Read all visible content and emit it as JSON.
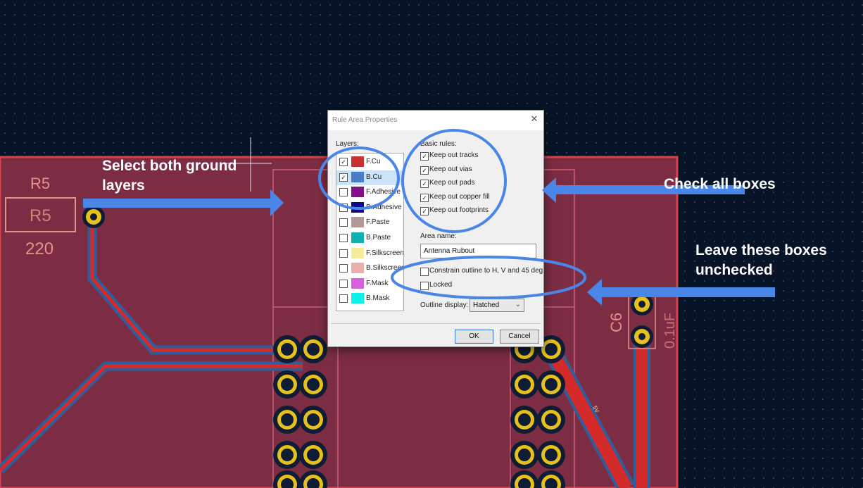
{
  "pcb": {
    "ref_top": "R5",
    "ref_body": "R5",
    "value_r5": "220",
    "ref_c6": "C6",
    "value_c6": "0.1uF",
    "net_5v": "5V",
    "colors": {
      "background": "#071428",
      "board_fill": "#7c2d44",
      "board_edge": "#d8424a",
      "trace_red": "#d42a2a",
      "trace_blue": "#2e5e9c",
      "pad_gold": "#e8c01c"
    }
  },
  "dialog": {
    "title": "Rule Area Properties",
    "close_icon": "close-icon",
    "layers_label": "Layers:",
    "layers": [
      {
        "name": "F.Cu",
        "checked": true,
        "color": "#c83232",
        "selected": false
      },
      {
        "name": "B.Cu",
        "checked": true,
        "color": "#4a7cc4",
        "selected": true
      },
      {
        "name": "F.Adhesive",
        "checked": false,
        "color": "#84108a",
        "selected": false
      },
      {
        "name": "B.Adhesive",
        "checked": false,
        "color": "#0a0a8a",
        "selected": false
      },
      {
        "name": "F.Paste",
        "checked": false,
        "color": "#b09a98",
        "selected": false
      },
      {
        "name": "B.Paste",
        "checked": false,
        "color": "#10b0b0",
        "selected": false
      },
      {
        "name": "F.Silkscreen",
        "checked": false,
        "color": "#f4ee9a",
        "selected": false
      },
      {
        "name": "B.Silkscreen",
        "checked": false,
        "color": "#e8b0a8",
        "selected": false
      },
      {
        "name": "F.Mask",
        "checked": false,
        "color": "#d860e0",
        "selected": false
      },
      {
        "name": "B.Mask",
        "checked": false,
        "color": "#10f0e8",
        "selected": false
      }
    ],
    "basic_rules_label": "Basic rules:",
    "rules": [
      {
        "label": "Keep out tracks",
        "checked": true
      },
      {
        "label": "Keep out vias",
        "checked": true
      },
      {
        "label": "Keep out pads",
        "checked": true
      },
      {
        "label": "Keep out copper fill",
        "checked": true
      },
      {
        "label": "Keep out footprints",
        "checked": true
      }
    ],
    "area_name_label": "Area name:",
    "area_name_value": "Antenna Rubout",
    "constrain_label": "Constrain outline to H, V and 45 deg",
    "constrain_checked": false,
    "locked_label": "Locked",
    "locked_checked": false,
    "outline_display_label": "Outline display:",
    "outline_display_value": "Hatched",
    "ok_label": "OK",
    "cancel_label": "Cancel"
  },
  "annotations": {
    "select_layers_line1": "Select both ground",
    "select_layers_line2": "layers",
    "check_all": "Check all boxes",
    "leave_unchecked_line1": "Leave these boxes",
    "leave_unchecked_line2": "unchecked",
    "arrow_color": "#4a86e8",
    "ring_color": "#4a86e8"
  }
}
